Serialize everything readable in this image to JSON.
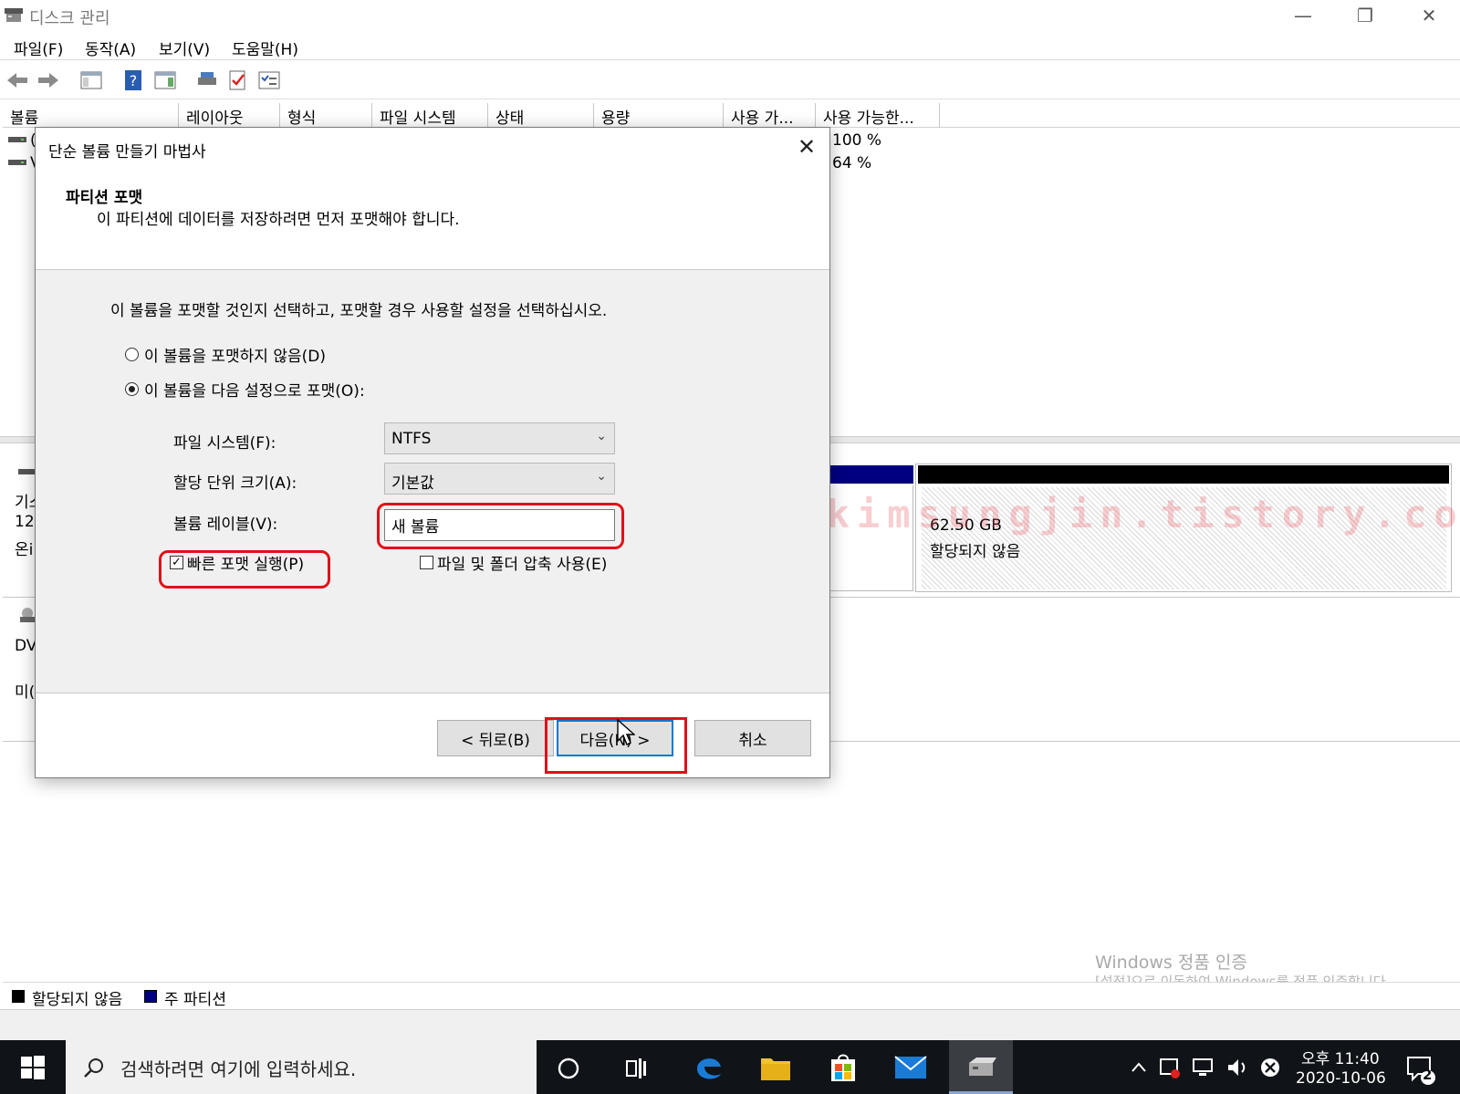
{
  "window": {
    "title": "디스크 관리",
    "controls": {
      "minimize": "—",
      "restore": "❐",
      "close": "✕"
    }
  },
  "menubar": [
    "파일(F)",
    "동작(A)",
    "보기(V)",
    "도움말(H)"
  ],
  "toolbar": {
    "icons": [
      "back-icon",
      "forward-icon",
      "console-tree-icon",
      "help-icon",
      "properties-icon",
      "disk-icon",
      "check-icon",
      "list-icon"
    ]
  },
  "volume_list": {
    "columns": [
      "볼륨",
      "레이아웃",
      "형식",
      "파일 시스템",
      "상태",
      "용량",
      "사용 가...",
      "사용 가능한..."
    ],
    "rows": [
      {
        "frag": "(",
        "pct": "100 %"
      },
      {
        "frag": "V",
        "pct": "64 %"
      }
    ]
  },
  "disk_area": {
    "disk0_fragments": [
      "기스",
      "12(",
      "온i"
    ],
    "dvd_fragments": [
      "DV",
      "미("
    ],
    "unallocated": {
      "size": "62.50 GB",
      "status": "할당되지 않음"
    }
  },
  "legend": {
    "items": [
      {
        "label": "할당되지 않음",
        "color": "#000000"
      },
      {
        "label": "주 파티션",
        "color": "#000080"
      }
    ]
  },
  "watermark": {
    "text": ":: 소소한 IT 정보 :: https://kimsungjin.tistory.com ::",
    "activation_title": "Windows 정품 인증",
    "activation_sub": "[설정]으로 이동하여 Windows를 정품 인증합니다."
  },
  "dialog": {
    "title": "단순 볼륨 만들기 마법사",
    "close": "✕",
    "heading": "파티션 포맷",
    "subheading": "이 파티션에 데이터를 저장하려면 먼저 포맷해야 합니다.",
    "instruction": "이 볼륨을 포맷할 것인지 선택하고, 포맷할 경우 사용할 설정을 선택하십시오.",
    "radio_no_format": "이 볼륨을 포맷하지 않음(D)",
    "radio_format": "이 볼륨을 다음 설정으로 포맷(O):",
    "fs_label": "파일 시스템(F):",
    "fs_value": "NTFS",
    "alloc_label": "할당 단위 크기(A):",
    "alloc_value": "기본값",
    "vol_label_label": "볼륨 레이블(V):",
    "vol_label_value": "새 볼륨",
    "quick_format": "빠른 포맷 실행(P)",
    "compression": "파일 및 폴더 압축 사용(E)",
    "btn_back": "< 뒤로(B)",
    "btn_next": "다음(N) >",
    "btn_cancel": "취소"
  },
  "taskbar": {
    "search_placeholder": "검색하려면 여기에 입력하세요.",
    "time": "오후 11:40",
    "date": "2020-10-06",
    "notifications": "2"
  }
}
